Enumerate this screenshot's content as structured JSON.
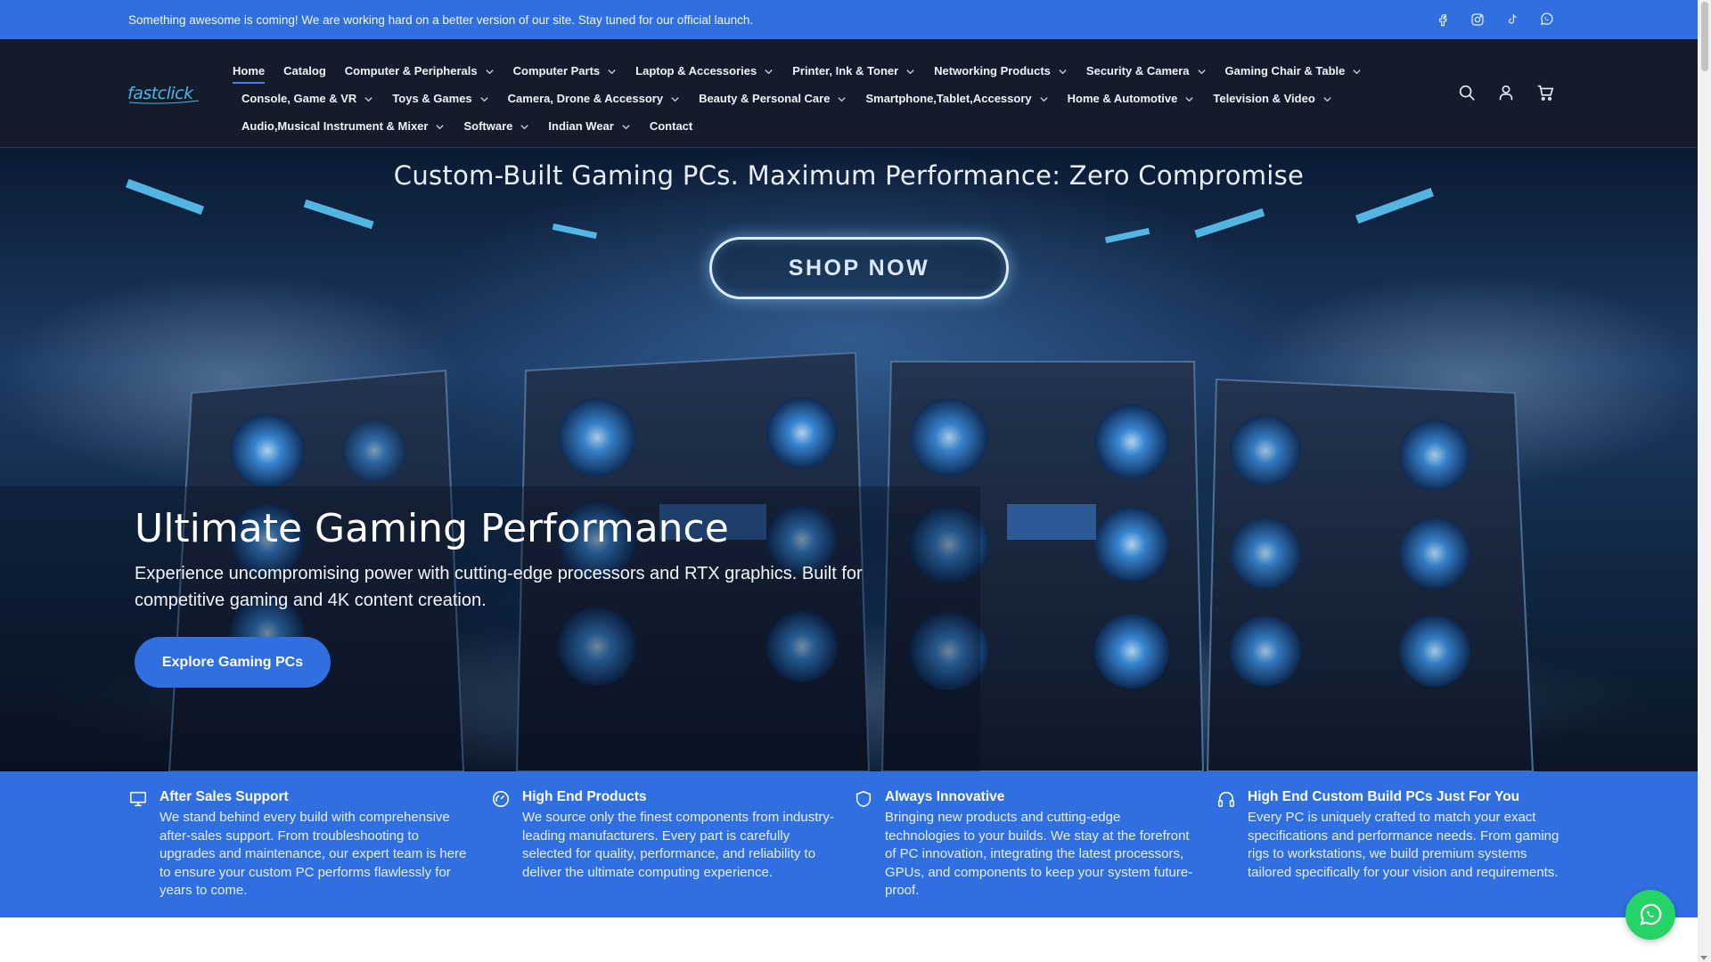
{
  "announcement": {
    "text": "Something awesome is coming! We are working hard on a better version of our site. Stay tuned for our official launch.",
    "socials": [
      "facebook-icon",
      "instagram-icon",
      "tiktok-icon",
      "whatsapp-icon"
    ]
  },
  "header": {
    "logo_text": "fastclick",
    "nav_rows": [
      [
        {
          "label": "Home",
          "dropdown": false,
          "active": true
        },
        {
          "label": "Catalog",
          "dropdown": false
        },
        {
          "label": "Computer & Peripherals",
          "dropdown": true
        },
        {
          "label": "Computer Parts",
          "dropdown": true
        },
        {
          "label": "Laptop & Accessories",
          "dropdown": true
        },
        {
          "label": "Printer, Ink & Toner",
          "dropdown": true
        },
        {
          "label": "Networking Products",
          "dropdown": true
        },
        {
          "label": "Security & Camera",
          "dropdown": true
        },
        {
          "label": "Gaming Chair & Table",
          "dropdown": true
        }
      ],
      [
        {
          "label": "Console, Game & VR",
          "dropdown": true
        },
        {
          "label": "Toys & Games",
          "dropdown": true
        },
        {
          "label": "Camera, Drone & Accessory",
          "dropdown": true
        },
        {
          "label": "Beauty & Personal Care",
          "dropdown": true
        },
        {
          "label": "Smartphone,Tablet,Accessory",
          "dropdown": true
        },
        {
          "label": "Home & Automotive",
          "dropdown": true
        },
        {
          "label": "Television & Video",
          "dropdown": true
        }
      ],
      [
        {
          "label": "Audio,Musical Instrument & Mixer",
          "dropdown": true
        },
        {
          "label": "Software",
          "dropdown": true
        },
        {
          "label": "Indian Wear",
          "dropdown": true
        },
        {
          "label": "Contact",
          "dropdown": false
        }
      ]
    ],
    "icons": [
      "search-icon",
      "account-icon",
      "cart-icon"
    ]
  },
  "hero": {
    "banner_title": "Custom-Built Gaming PCs. Maximum Performance: Zero Compromise",
    "shop_now": "SHOP NOW",
    "heading": "Ultimate Gaming Performance",
    "subtext": "Experience uncompromising power with cutting-edge processors and RTX graphics. Built for competitive gaming and 4K content creation.",
    "cta": "Explore Gaming PCs"
  },
  "features": [
    {
      "icon": "monitor-icon",
      "title": "After Sales Support",
      "text": "We stand behind every build with comprehensive after-sales support. From troubleshooting to upgrades and maintenance, our expert team is here to ensure your custom PC performs flawlessly for years to come."
    },
    {
      "icon": "gauge-icon",
      "title": "High End Products",
      "text": "We source only the finest components from industry-leading manufacturers. Every part is carefully selected for quality, performance, and reliability to deliver the ultimate computing experience."
    },
    {
      "icon": "shield-icon",
      "title": "Always Innovative",
      "text": "Bringing new products and cutting-edge technologies to your builds. We stay at the forefront of PC innovation, integrating the latest processors, GPUs, and components to keep your system future-proof."
    },
    {
      "icon": "headphones-icon",
      "title": "High End Custom Build PCs Just For You",
      "text": "Every PC is uniquely crafted to match your exact specifications and performance needs. From gaming rigs to workstations, we build premium systems tailored specifically for your vision and requirements."
    }
  ],
  "colors": {
    "brand_blue": "#2f6fe0",
    "header_bg": "#141b2b",
    "whatsapp_green": "#25d366"
  }
}
